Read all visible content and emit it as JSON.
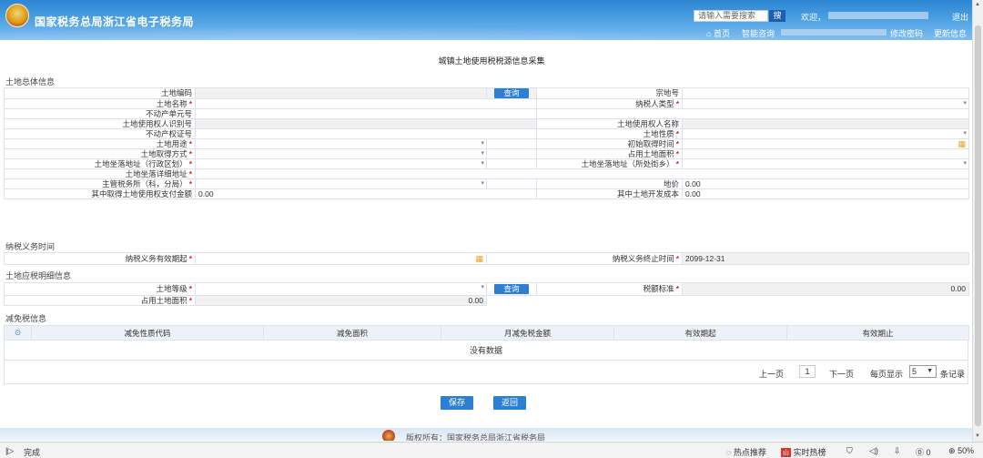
{
  "header": {
    "site_title": "国家税务总局浙江省电子税务局",
    "search_placeholder": "请输入需要搜索",
    "search_button": "搜",
    "welcome": "欢迎，",
    "logout": "退出",
    "nav": {
      "home": "首页",
      "consult": "智能咨询",
      "change_password": "修改密码",
      "update_info": "更新信息"
    }
  },
  "page_title": "城镇土地使用税税源信息采集",
  "sections": {
    "land_info": "土地总体信息",
    "tax_period": "纳税义务时间",
    "tax_detail": "土地应税明细信息",
    "exemption": "减免税信息"
  },
  "land_form": {
    "land_code": "土地编码",
    "query": "查询",
    "parcel_no": "宗地号",
    "land_name": "土地名称",
    "taxpayer_type": "纳税人类型",
    "realty_unit_no": "不动产单元号",
    "user_id": "土地使用权人识别号",
    "user_name": "土地使用权人名称",
    "realty_cert_no": "不动产权证号",
    "land_nature": "土地性质",
    "land_use": "土地用途",
    "initial_acquire_time": "初始取得时间",
    "acquire_method": "土地取得方式",
    "occupied_area": "占用土地面积",
    "address_district": "土地坐落地址（行政区划）",
    "address_street": "土地坐落地址（所处街乡）",
    "address_detail": "土地坐落详细地址",
    "tax_office": "主管税务所（科，分局）",
    "land_price_label": "地价",
    "land_price_value": "0.00",
    "acq_payment_label": "其中取得土地使用权支付金额",
    "acq_payment_value": "0.00",
    "dev_cost_label": "其中土地开发成本",
    "dev_cost_value": "0.00"
  },
  "tax_period_form": {
    "start_label": "纳税义务有效期起",
    "end_label": "纳税义务终止时间",
    "end_value": "2099-12-31"
  },
  "tax_detail_form": {
    "grade_label": "土地等级",
    "query": "查询",
    "standard_label": "税额标准",
    "standard_value": "0.00",
    "area_label": "占用土地面积",
    "area_value": "0.00"
  },
  "exemption_grid": {
    "columns": [
      "减免性质代码",
      "减免面积",
      "月减免税金额",
      "有效期起",
      "有效期止"
    ],
    "empty_text": "没有数据"
  },
  "pager": {
    "prev": "上一页",
    "current_page": "1",
    "next": "下一页",
    "per_page_label": "每页显示",
    "per_page_value": "5",
    "records_label": "条记录"
  },
  "actions": {
    "save": "保存",
    "back": "返回"
  },
  "footer": {
    "copyright": "版权所有：国家税务总局浙江省税务局"
  },
  "statusbar": {
    "done": "完成",
    "hot": "热点推荐",
    "realtime": "实时热榜",
    "count": "0",
    "zoom": "50%"
  }
}
